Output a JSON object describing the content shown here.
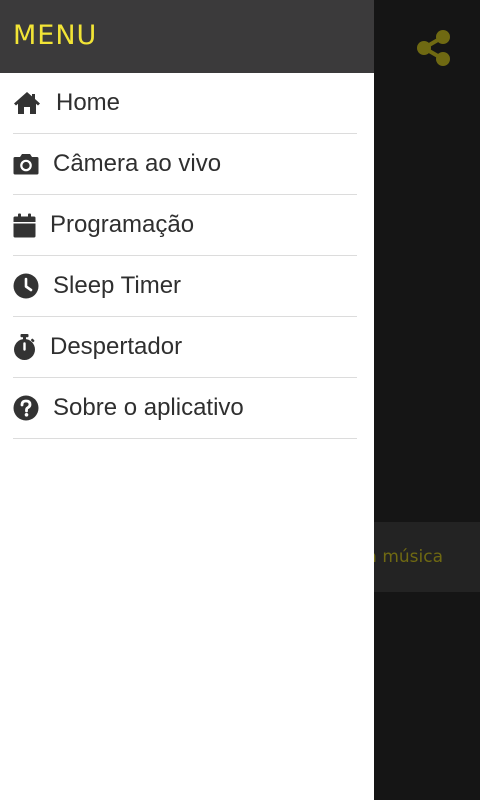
{
  "app": {
    "background_text": "a música",
    "share_icon": "share-icon"
  },
  "drawer": {
    "title": "MENU",
    "items": [
      {
        "label": "Home",
        "icon": "home-icon"
      },
      {
        "label": "Câmera ao vivo",
        "icon": "camera-icon"
      },
      {
        "label": "Programação",
        "icon": "calendar-icon"
      },
      {
        "label": "Sleep Timer",
        "icon": "clock-icon"
      },
      {
        "label": "Despertador",
        "icon": "stopwatch-icon"
      },
      {
        "label": "Sobre o aplicativo",
        "icon": "question-circle-icon"
      }
    ]
  },
  "colors": {
    "header_bg": "#3b3a3b",
    "title_accent": "#f2e436",
    "app_bg": "#151515",
    "share_icon": "#6f6912"
  }
}
